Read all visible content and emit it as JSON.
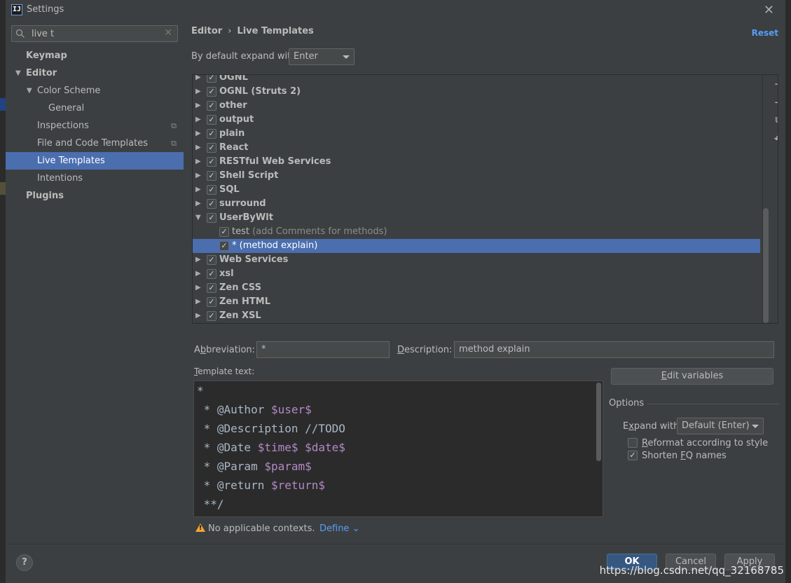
{
  "window": {
    "title": "Settings",
    "app_icon_text": "IJ"
  },
  "sidebar": {
    "search_value": "live t",
    "items": [
      {
        "label": "Keymap"
      },
      {
        "label": "Editor"
      },
      {
        "label": "Color Scheme"
      },
      {
        "label": "General"
      },
      {
        "label": "Inspections"
      },
      {
        "label": "File and Code Templates"
      },
      {
        "label": "Live Templates"
      },
      {
        "label": "Intentions"
      },
      {
        "label": "Plugins"
      }
    ]
  },
  "header": {
    "breadcrumb_editor": "Editor",
    "breadcrumb_sep": "›",
    "breadcrumb_page": "Live Templates",
    "reset": "Reset"
  },
  "expand": {
    "label": "By default expand with",
    "value": "Enter"
  },
  "templates": {
    "groups": [
      {
        "label": "OGNL",
        "checked": true
      },
      {
        "label": "OGNL (Struts 2)",
        "checked": true
      },
      {
        "label": "other",
        "checked": true
      },
      {
        "label": "output",
        "checked": true
      },
      {
        "label": "plain",
        "checked": true
      },
      {
        "label": "React",
        "checked": true
      },
      {
        "label": "RESTful Web Services",
        "checked": true
      },
      {
        "label": "Shell Script",
        "checked": true
      },
      {
        "label": "SQL",
        "checked": true
      },
      {
        "label": "surround",
        "checked": true
      },
      {
        "label": "UserByWlt",
        "checked": true
      },
      {
        "label": "test",
        "desc": "(add Comments for methods)",
        "checked": true
      },
      {
        "label": "*",
        "desc": "(method explain)",
        "checked": true
      },
      {
        "label": "Web Services",
        "checked": true
      },
      {
        "label": "xsl",
        "checked": true
      },
      {
        "label": "Zen CSS",
        "checked": true
      },
      {
        "label": "Zen HTML",
        "checked": true
      },
      {
        "label": "Zen XSL",
        "checked": true
      }
    ]
  },
  "form": {
    "abbreviation_label_pre": "A",
    "abbreviation_label_u": "b",
    "abbreviation_label_post": "breviation:",
    "abbreviation_value": "*",
    "description_label_u": "D",
    "description_label_post": "escription:",
    "description_value": "method explain",
    "template_text_label_u": "T",
    "template_text_label_post": "emplate text:",
    "template_lines": [
      {
        "text": "*"
      },
      {
        "text": " * @Author ",
        "var": "$user$"
      },
      {
        "text": " * @Description //TODO"
      },
      {
        "text": " * @Date ",
        "var": "$time$",
        "var2": "$date$"
      },
      {
        "text": " * @Param ",
        "var": "$param$"
      },
      {
        "text": " * @return ",
        "var": "$return$"
      },
      {
        "text": " **/"
      }
    ],
    "edit_variables_u": "E",
    "edit_variables_post": "dit variables"
  },
  "options": {
    "title": "Options",
    "expand_with_pre": "E",
    "expand_with_u": "x",
    "expand_with_post": "pand with",
    "expand_with_value": "Default (Enter)",
    "reformat_u": "R",
    "reformat_post": "eformat according to style",
    "reformat_checked": false,
    "shorten_pre": "Shorten ",
    "shorten_u": "F",
    "shorten_post": "Q names",
    "shorten_checked": true
  },
  "contexts": {
    "warning": "No applicable contexts.",
    "define": "Define"
  },
  "footer": {
    "help": "?",
    "ok": "OK",
    "cancel": "Cancel",
    "apply": "Apply",
    "watermark": "https://blog.csdn.net/qq_32168785"
  },
  "colors": {
    "selection": "#4b6eaf",
    "link": "#589df6",
    "template_var": "#b389c5"
  }
}
